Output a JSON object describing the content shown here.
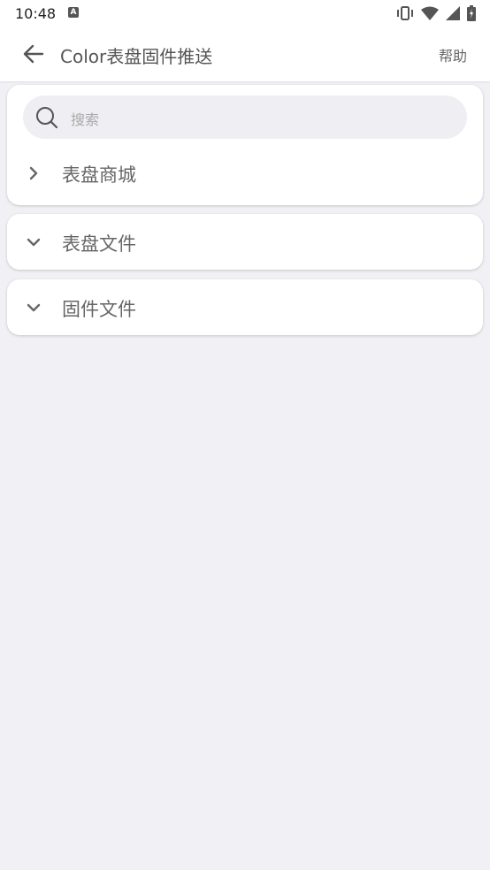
{
  "status": {
    "time": "10:48",
    "a_icon": "A"
  },
  "appbar": {
    "title": "Color表盘固件推送",
    "help_label": "帮助"
  },
  "search": {
    "placeholder": "搜索"
  },
  "sections": [
    {
      "label": "表盘商城",
      "state": "collapsed"
    },
    {
      "label": "表盘文件",
      "state": "expanded"
    },
    {
      "label": "固件文件",
      "state": "expanded"
    }
  ],
  "colors": {
    "background": "#f1f1f5",
    "card": "#ffffff",
    "accent_text": "#666666"
  }
}
